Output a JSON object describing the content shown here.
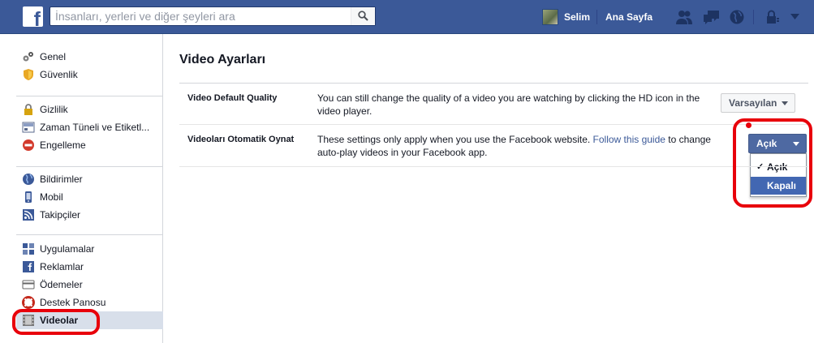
{
  "header": {
    "logo_letter": "f",
    "search_placeholder": "İnsanları, yerleri ve diğer şeyleri ara",
    "user_name": "Selim",
    "home_label": "Ana Sayfa",
    "brand_color": "#3b5998"
  },
  "sidebar": {
    "groups": [
      [
        {
          "label": "Genel",
          "icon": "gears-icon"
        },
        {
          "label": "Güvenlik",
          "icon": "shield-icon"
        }
      ],
      [
        {
          "label": "Gizlilik",
          "icon": "lock-icon"
        },
        {
          "label": "Zaman Tüneli ve Etiketl...",
          "icon": "timeline-icon"
        },
        {
          "label": "Engelleme",
          "icon": "block-icon"
        }
      ],
      [
        {
          "label": "Bildirimler",
          "icon": "globe-icon"
        },
        {
          "label": "Mobil",
          "icon": "mobile-icon"
        },
        {
          "label": "Takipçiler",
          "icon": "rss-icon"
        }
      ],
      [
        {
          "label": "Uygulamalar",
          "icon": "apps-icon"
        },
        {
          "label": "Reklamlar",
          "icon": "ads-icon"
        },
        {
          "label": "Ödemeler",
          "icon": "card-icon"
        },
        {
          "label": "Destek Panosu",
          "icon": "lifebuoy-icon"
        },
        {
          "label": "Videolar",
          "icon": "film-icon",
          "active": true
        }
      ]
    ]
  },
  "main": {
    "title": "Video Ayarları",
    "rows": [
      {
        "label": "Video Default Quality",
        "text": "You can still change the quality of a video you are watching by clicking the HD icon in the video player.",
        "button": "Varsayılan"
      },
      {
        "label": "Videoları Otomatik Oynat",
        "text_before": "These settings only apply when you use the Facebook website. ",
        "link": "Follow this guide",
        "text_after": " to change auto-play videos in your Facebook app.",
        "button": "Açık",
        "menu": [
          {
            "label": "Açık",
            "checked": true
          },
          {
            "label": "Kapalı",
            "highlighted": true
          }
        ]
      }
    ]
  },
  "annotation_color": "#e8000b"
}
